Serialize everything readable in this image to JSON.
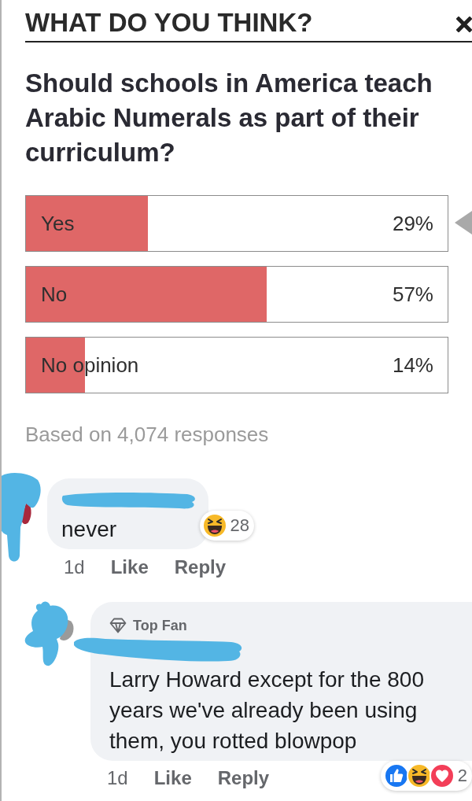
{
  "poll": {
    "heading": "WHAT DO YOU THINK?",
    "question": "Should schools in America teach Arabic Numerals as part of their curriculum?",
    "options": [
      {
        "label": "Yes",
        "level": 0.29,
        "percent": "29%"
      },
      {
        "label": "No",
        "level": 0.57,
        "percent": "57%"
      },
      {
        "label": "No opinion",
        "level": 0.14,
        "percent": "14%"
      }
    ],
    "summary": "Based on 4,074 responses"
  },
  "comments": [
    {
      "text": "never",
      "time": "1d",
      "actions": [
        "Like",
        "Reply"
      ],
      "reactions": [
        {
          "kind": "haha"
        }
      ],
      "reaction_count": "28",
      "children": [
        {
          "badge": "Top Fan",
          "text": "Larry Howard except for the 800 years we've already been using them, you rotted blowpop",
          "time": "1d",
          "actions": [
            "Like",
            "Reply"
          ],
          "reactions": [
            {
              "kind": "like"
            },
            {
              "kind": "haha"
            },
            {
              "kind": "love"
            }
          ],
          "reaction_count": "2"
        }
      ]
    }
  ]
}
